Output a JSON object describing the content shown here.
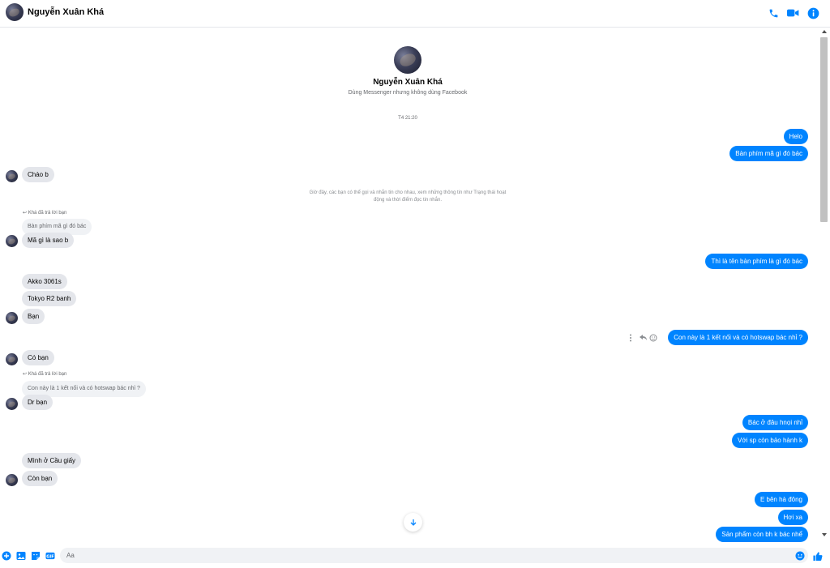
{
  "header": {
    "name": "Nguyễn Xuân Khá"
  },
  "profile": {
    "name": "Nguyễn Xuân Khá",
    "subtitle": "Dùng Messenger nhưng không dùng Facebook"
  },
  "timestamp": "T4 21:20",
  "notice": "Giờ đây, các bạn có thể gọi và nhắn tin cho nhau, xem những thông tin như Trạng thái hoạt động và thời điểm đọc tin nhắn.",
  "reply_labels": [
    "Khá đã trả lời bạn",
    "Khá đã trả lời bạn"
  ],
  "quotes": [
    "Bàn phím mã gì đó bác",
    "Con này là 1 kết nối và có hotswap bác nhỉ ?"
  ],
  "messages": [
    {
      "text": "Helo",
      "from": "me"
    },
    {
      "text": "Bàn phím mã gì đó bác",
      "from": "me"
    },
    {
      "text": "Chào b",
      "from": "them"
    },
    {
      "text": "Mã gì là sao b",
      "from": "them"
    },
    {
      "text": "Thì là tên bàn phím là gì đó bác",
      "from": "me"
    },
    {
      "text": "Akko 3061s",
      "from": "them"
    },
    {
      "text": "Tokyo R2 banh",
      "from": "them"
    },
    {
      "text": "Bạn",
      "from": "them"
    },
    {
      "text": "Con này là 1 kết nối và có hotswap bác nhỉ ?",
      "from": "me"
    },
    {
      "text": "Có bạn",
      "from": "them"
    },
    {
      "text": "Dr bạn",
      "from": "them"
    },
    {
      "text": "Bác ở đâu hnọi nhỉ",
      "from": "me"
    },
    {
      "text": "Với sp còn bảo hành k",
      "from": "me"
    },
    {
      "text": "Mình ở Cầu giấy",
      "from": "them"
    },
    {
      "text": "Còn bạn",
      "from": "them"
    },
    {
      "text": "E bên hà đông",
      "from": "me"
    },
    {
      "text": "Hơi xa",
      "from": "me"
    },
    {
      "text": "Sản phẩm còn bh k bác nhể",
      "from": "me"
    }
  ],
  "composer": {
    "placeholder": "Aa"
  },
  "icons": {
    "header": [
      "phone-icon",
      "video-icon",
      "info-icon"
    ],
    "composer": [
      "plus-icon",
      "image-icon",
      "sticker-icon",
      "gif-icon",
      "emoji-icon",
      "like-icon"
    ],
    "message_actions": [
      "more-icon",
      "reply-icon",
      "react-icon"
    ]
  },
  "colors": {
    "accent": "#0084ff",
    "incoming_bubble": "#e4e6eb"
  }
}
